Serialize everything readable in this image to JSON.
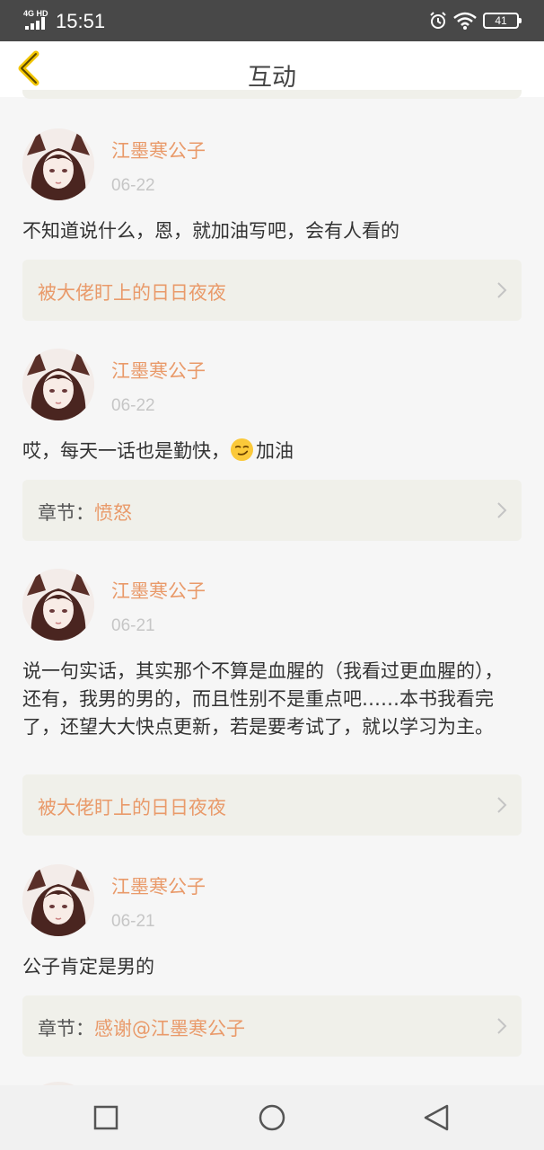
{
  "status_bar": {
    "network": "4G HD",
    "time": "15:51",
    "battery": "41"
  },
  "header": {
    "title": "互动"
  },
  "comments": [
    {
      "user": "江墨寒公子",
      "date": "06-22",
      "text": "不知道说什么，恩，就加油写吧，会有人看的",
      "ref_prefix": "",
      "ref_title": "被大佬盯上的日日夜夜"
    },
    {
      "user": "江墨寒公子",
      "date": "06-22",
      "text_before": "哎，每天一话也是勤快，",
      "emoji": "smirk-face",
      "text_after": "加油",
      "ref_prefix": "章节：",
      "ref_title": "愤怒"
    },
    {
      "user": "江墨寒公子",
      "date": "06-21",
      "text": "说一句实话，其实那个不算是血腥的（我看过更血腥的），还有，我男的男的，而且性别不是重点吧……本书我看完了，还望大大快点更新，若是要考试了，就以学习为主。",
      "ref_prefix": "",
      "ref_title": "被大佬盯上的日日夜夜"
    },
    {
      "user": "江墨寒公子",
      "date": "06-21",
      "text": "公子肯定是男的",
      "ref_prefix": "章节：",
      "ref_title": "感谢@江墨寒公子"
    }
  ],
  "nav": {
    "recent_icon": "square-icon",
    "home_icon": "circle-icon",
    "back_icon": "triangle-back-icon"
  },
  "colors": {
    "accent": "#e99a6a",
    "back_arrow": "#f2c500",
    "card_bg": "#f0f0ea"
  }
}
